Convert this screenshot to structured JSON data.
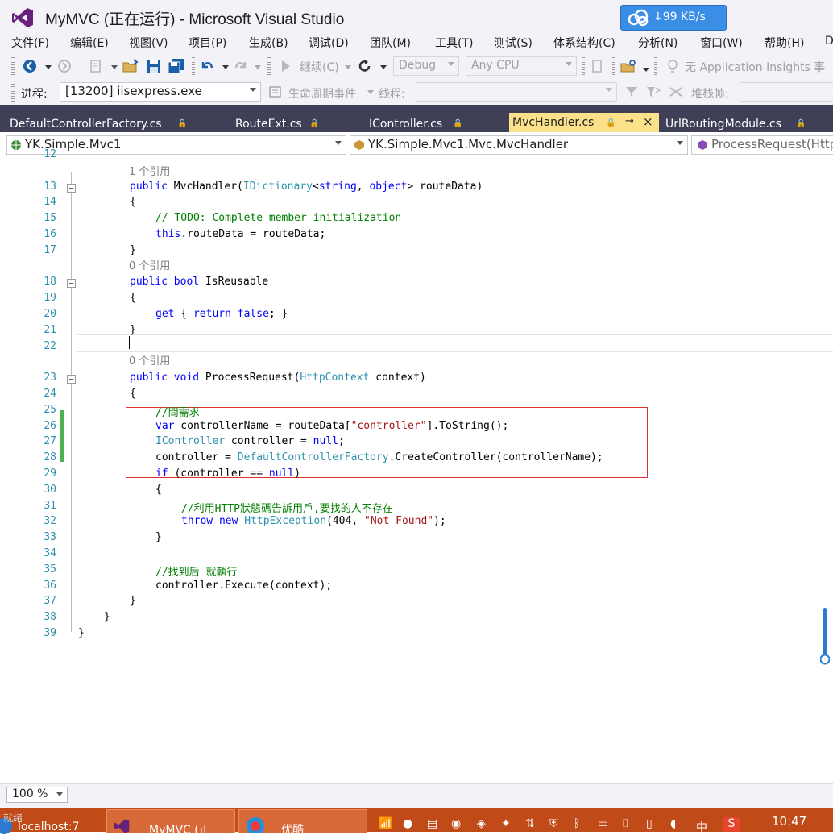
{
  "window": {
    "title": "MyMVC (正在运行) - Microsoft Visual Studio",
    "net_speed": "↓99 KB/s"
  },
  "menu": [
    "文件(F)",
    "编辑(E)",
    "视图(V)",
    "项目(P)",
    "生成(B)",
    "调试(D)",
    "团队(M)",
    "工具(T)",
    "测试(S)",
    "体系结构(C)",
    "分析(N)",
    "窗口(W)",
    "帮助(H)",
    "D"
  ],
  "toolbar": {
    "continue_label": "继续(C)",
    "config": "Debug",
    "platform": "Any CPU",
    "insights_label": "无 Application Insights 事",
    "process_label": "进程:",
    "process_value": "[13200] iisexpress.exe",
    "lifecycle_label": "生命周期事件",
    "thread_label": "线程:",
    "stackframe_label": "堆栈帧:"
  },
  "tabs": [
    {
      "label": "DefaultControllerFactory.cs"
    },
    {
      "label": "RouteExt.cs"
    },
    {
      "label": "IController.cs"
    },
    {
      "label": "MvcHandler.cs",
      "active": true
    },
    {
      "label": "UrlRoutingModule.cs"
    }
  ],
  "nav": {
    "project": "YK.Simple.Mvc1",
    "class": "YK.Simple.Mvc1.Mvc.MvcHandler",
    "member": "ProcessRequest(Http"
  },
  "code": {
    "ref1": "1 个引用",
    "ref0a": "0 个引用",
    "ref0b": "0 个引用",
    "lines": [
      {
        "n": "12"
      },
      {
        "n": "13",
        "t": [
          {
            "k": "kw",
            "v": "public"
          },
          {
            "v": " MvcHandler("
          },
          {
            "k": "ty",
            "v": "IDictionary"
          },
          {
            "v": "<"
          },
          {
            "k": "kw",
            "v": "string"
          },
          {
            "v": ", "
          },
          {
            "k": "kw",
            "v": "object"
          },
          {
            "v": "> routeData)"
          }
        ]
      },
      {
        "n": "14",
        "t": [
          {
            "v": "{"
          }
        ]
      },
      {
        "n": "15",
        "t": [
          {
            "k": "cm",
            "v": "// TODO: Complete member initialization"
          }
        ]
      },
      {
        "n": "16",
        "t": [
          {
            "k": "kw",
            "v": "this"
          },
          {
            "v": ".routeData = routeData;"
          }
        ]
      },
      {
        "n": "17",
        "t": [
          {
            "v": "}"
          }
        ]
      },
      {
        "n": "18",
        "t": [
          {
            "k": "kw",
            "v": "public"
          },
          {
            "v": " "
          },
          {
            "k": "kw",
            "v": "bool"
          },
          {
            "v": " IsReusable"
          }
        ]
      },
      {
        "n": "19",
        "t": [
          {
            "v": "{"
          }
        ]
      },
      {
        "n": "20",
        "t": [
          {
            "k": "kw",
            "v": "get"
          },
          {
            "v": " { "
          },
          {
            "k": "kw",
            "v": "return"
          },
          {
            "v": " "
          },
          {
            "k": "kw",
            "v": "false"
          },
          {
            "v": "; }"
          }
        ]
      },
      {
        "n": "21",
        "t": [
          {
            "v": "}"
          }
        ]
      },
      {
        "n": "22",
        "t": []
      },
      {
        "n": "23",
        "t": [
          {
            "k": "kw",
            "v": "public"
          },
          {
            "v": " "
          },
          {
            "k": "kw",
            "v": "void"
          },
          {
            "v": " ProcessRequest("
          },
          {
            "k": "ty",
            "v": "HttpContext"
          },
          {
            "v": " context)"
          }
        ]
      },
      {
        "n": "24",
        "t": [
          {
            "v": "{"
          }
        ]
      },
      {
        "n": "25",
        "t": [
          {
            "k": "cm",
            "v": "//問需求"
          }
        ]
      },
      {
        "n": "26",
        "t": [
          {
            "k": "kw",
            "v": "var"
          },
          {
            "v": " controllerName = routeData["
          },
          {
            "k": "st",
            "v": "\"controller\""
          },
          {
            "v": "].ToString();"
          }
        ]
      },
      {
        "n": "27",
        "t": [
          {
            "k": "ty",
            "v": "IController"
          },
          {
            "v": " controller = "
          },
          {
            "k": "kw",
            "v": "null"
          },
          {
            "v": ";"
          }
        ]
      },
      {
        "n": "28",
        "t": [
          {
            "v": "controller = "
          },
          {
            "k": "ty",
            "v": "DefaultControllerFactory"
          },
          {
            "v": ".CreateController(controllerName);"
          }
        ]
      },
      {
        "n": "29",
        "t": [
          {
            "k": "kw",
            "v": "if"
          },
          {
            "v": " (controller == "
          },
          {
            "k": "kw",
            "v": "null"
          },
          {
            "v": ")"
          }
        ]
      },
      {
        "n": "30",
        "t": [
          {
            "v": "{"
          }
        ]
      },
      {
        "n": "31",
        "t": [
          {
            "k": "cm",
            "v": "//利用HTTP狀態碼告訴用戶,要找的人不存在"
          }
        ]
      },
      {
        "n": "32",
        "t": [
          {
            "k": "kw",
            "v": "throw"
          },
          {
            "v": " "
          },
          {
            "k": "kw",
            "v": "new"
          },
          {
            "v": " "
          },
          {
            "k": "ty",
            "v": "HttpException"
          },
          {
            "v": "(404, "
          },
          {
            "k": "st",
            "v": "\"Not Found\""
          },
          {
            "v": ");"
          }
        ]
      },
      {
        "n": "33",
        "t": [
          {
            "v": "}"
          }
        ]
      },
      {
        "n": "34",
        "t": []
      },
      {
        "n": "35",
        "t": [
          {
            "k": "cm",
            "v": "//找到后 就執行"
          }
        ]
      },
      {
        "n": "36",
        "t": [
          {
            "v": "controller.Execute(context);"
          }
        ]
      },
      {
        "n": "37",
        "t": [
          {
            "v": "}"
          }
        ]
      },
      {
        "n": "38",
        "t": [
          {
            "v": "}"
          }
        ]
      },
      {
        "n": "39",
        "t": [
          {
            "v": "}"
          }
        ]
      }
    ]
  },
  "status": {
    "zoom": "100 %"
  },
  "taskbar": {
    "tasks": [
      "localhost:7",
      "MyMVC (正",
      "优酷"
    ],
    "ime": "中",
    "clock": "10:47",
    "ready": "就绪"
  }
}
